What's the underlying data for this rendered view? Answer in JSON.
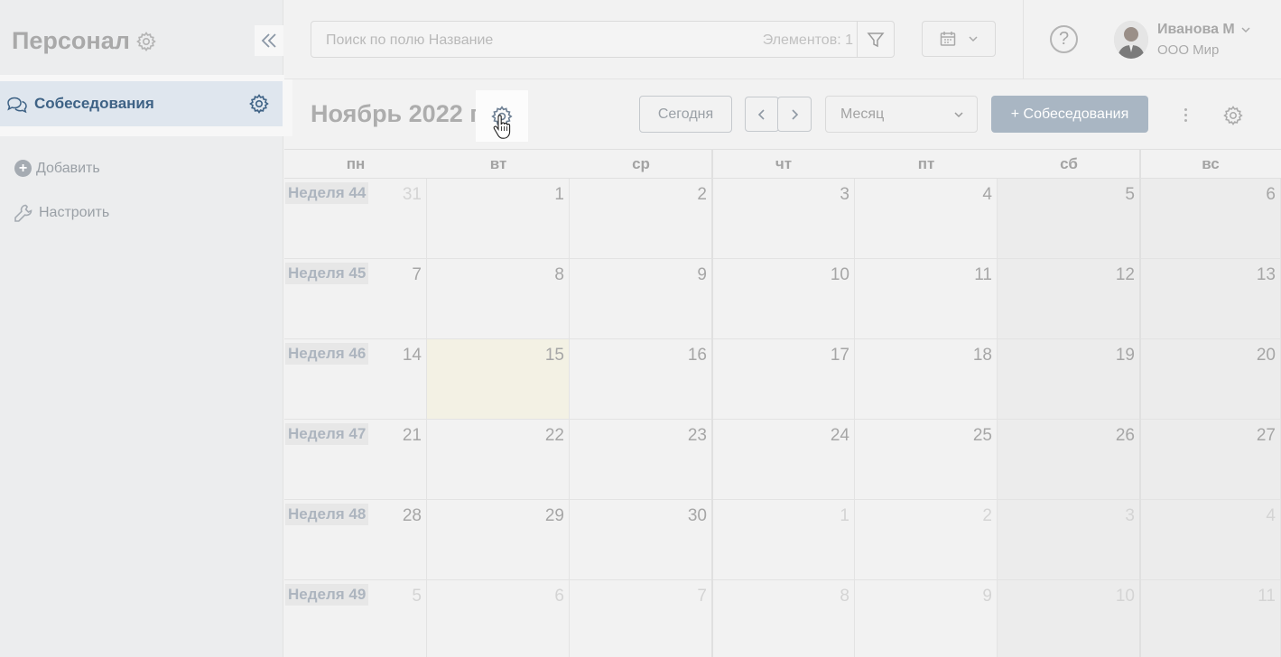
{
  "sidebar": {
    "title": "Персонал",
    "nav_items": [
      {
        "label": "Собеседования",
        "icon": "chat-icon"
      }
    ],
    "add_label": "Добавить",
    "configure_label": "Настроить"
  },
  "topbar": {
    "search_placeholder": "Поиск по полю Название",
    "count_text": "Элементов: 1",
    "help_label": "?",
    "user_name": "Иванова М",
    "user_org": "ООО Мир"
  },
  "toolbar": {
    "month_title": "Ноябрь 2022 г.",
    "today_label": "Сегодня",
    "view_label": "Месяц",
    "add_label": "+ Собеседования"
  },
  "calendar": {
    "weekdays": [
      "пн",
      "вт",
      "ср",
      "чт",
      "пт",
      "сб",
      "вс"
    ],
    "weeks": [
      {
        "label": "Неделя 44",
        "days": [
          "31",
          "1",
          "2",
          "3",
          "4",
          "5",
          "6"
        ]
      },
      {
        "label": "Неделя 45",
        "days": [
          "7",
          "8",
          "9",
          "10",
          "11",
          "12",
          "13"
        ]
      },
      {
        "label": "Неделя 46",
        "days": [
          "14",
          "15",
          "16",
          "17",
          "18",
          "19",
          "20"
        ]
      },
      {
        "label": "Неделя 47",
        "days": [
          "21",
          "22",
          "23",
          "24",
          "25",
          "26",
          "27"
        ]
      },
      {
        "label": "Неделя 48",
        "days": [
          "28",
          "29",
          "30",
          "1",
          "2",
          "3",
          "4"
        ]
      },
      {
        "label": "Неделя 49",
        "days": [
          "5",
          "6",
          "7",
          "8",
          "9",
          "10",
          "11"
        ]
      }
    ],
    "other_month": [
      [
        0,
        0
      ],
      [
        4,
        3
      ],
      [
        4,
        4
      ],
      [
        4,
        5
      ],
      [
        4,
        6
      ],
      [
        5,
        0
      ],
      [
        5,
        1
      ],
      [
        5,
        2
      ],
      [
        5,
        3
      ],
      [
        5,
        4
      ],
      [
        5,
        5
      ],
      [
        5,
        6
      ]
    ],
    "today": [
      2,
      1
    ]
  },
  "colors": {
    "accent": "#3e6285",
    "primary_button": "#a9b6c3",
    "today_bg": "#f3f1e4"
  }
}
